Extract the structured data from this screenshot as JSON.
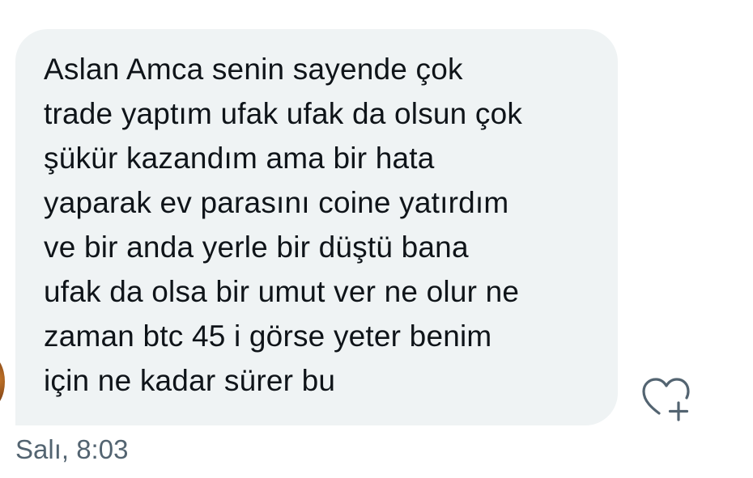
{
  "message": {
    "lines": [
      "Aslan Amca senin sayende çok",
      "trade yaptım ufak ufak da olsun çok",
      "şükür kazandım ama bir hata",
      "yaparak ev parasını coine yatırdım",
      "ve bir anda yerle bir düştü bana",
      "ufak da olsa bir umut ver ne olur ne",
      "zaman btc 45 i görse yeter benim",
      "için ne kadar sürer bu"
    ],
    "timestamp": "Salı, 8:03"
  },
  "icons": {
    "react": "heart-plus-icon",
    "avatar": "avatar"
  },
  "colors": {
    "bubble_background": "#eff3f4",
    "text": "#0f1419",
    "timestamp": "#536471",
    "icon": "#536471"
  }
}
